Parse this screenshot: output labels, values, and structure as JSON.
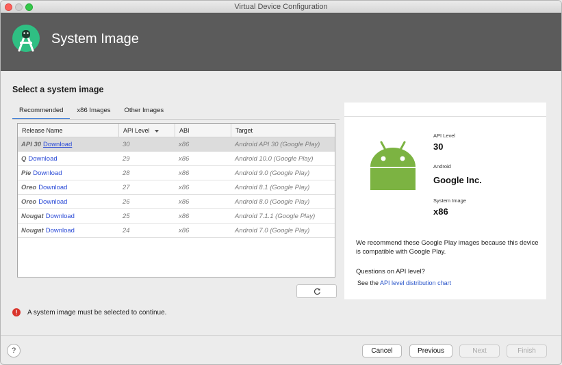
{
  "window": {
    "title": "Virtual Device Configuration"
  },
  "header": {
    "title": "System Image",
    "logo_icon": "android-studio-icon"
  },
  "section_title": "Select a system image",
  "tabs": [
    {
      "label": "Recommended",
      "active": true
    },
    {
      "label": "x86 Images",
      "active": false
    },
    {
      "label": "Other Images",
      "active": false
    }
  ],
  "table": {
    "columns": [
      "Release Name",
      "API Level",
      "ABI",
      "Target"
    ],
    "sort_column": "API Level",
    "download_label": "Download",
    "rows": [
      {
        "release": "API 30",
        "api": "30",
        "abi": "x86",
        "target": "Android API 30 (Google Play)",
        "selected": true
      },
      {
        "release": "Q",
        "api": "29",
        "abi": "x86",
        "target": "Android 10.0 (Google Play)",
        "selected": false
      },
      {
        "release": "Pie",
        "api": "28",
        "abi": "x86",
        "target": "Android 9.0 (Google Play)",
        "selected": false
      },
      {
        "release": "Oreo",
        "api": "27",
        "abi": "x86",
        "target": "Android 8.1 (Google Play)",
        "selected": false
      },
      {
        "release": "Oreo",
        "api": "26",
        "abi": "x86",
        "target": "Android 8.0 (Google Play)",
        "selected": false
      },
      {
        "release": "Nougat",
        "api": "25",
        "abi": "x86",
        "target": "Android 7.1.1 (Google Play)",
        "selected": false
      },
      {
        "release": "Nougat",
        "api": "24",
        "abi": "x86",
        "target": "Android 7.0 (Google Play)",
        "selected": false
      }
    ]
  },
  "details": {
    "api_level_label": "API Level",
    "api_level_value": "30",
    "android_label": "Android",
    "android_value": "Google Inc.",
    "system_image_label": "System Image",
    "system_image_value": "x86",
    "recommendation": "We recommend these Google Play images because this device is compatible with Google Play.",
    "question": "Questions on API level?",
    "see_prefix": "See the ",
    "chart_link": "API level distribution chart"
  },
  "error": {
    "message": "A system image must be selected to continue.",
    "icon": "!"
  },
  "footer": {
    "help": "?",
    "cancel": "Cancel",
    "previous": "Previous",
    "next": "Next",
    "finish": "Finish"
  },
  "colors": {
    "header_bg": "#5b5b5b",
    "android_green": "#7cb342",
    "link_blue": "#2a4ad6",
    "error_red": "#d9342b"
  }
}
